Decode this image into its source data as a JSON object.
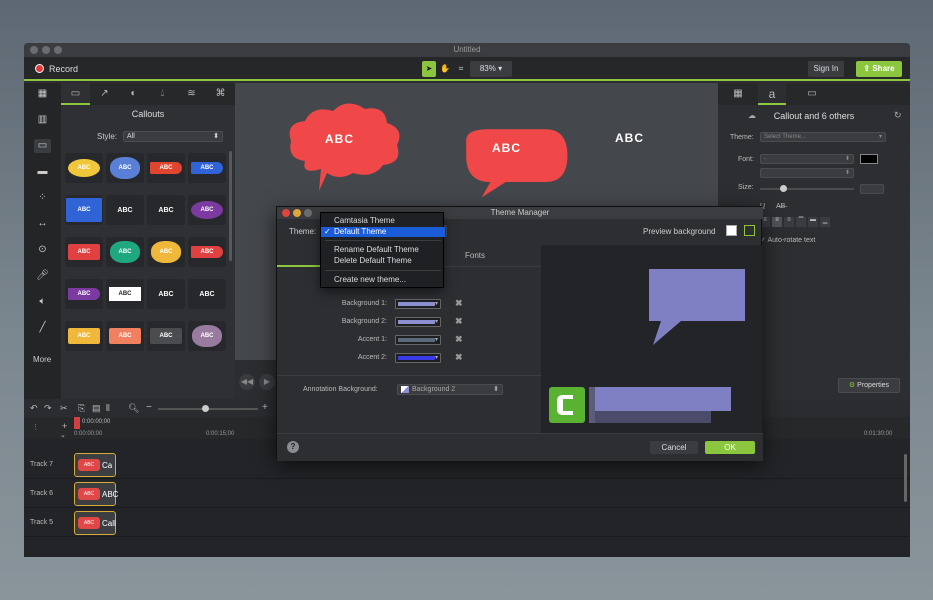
{
  "window": {
    "title": "Untitled"
  },
  "toolbar": {
    "record_label": "Record",
    "zoom": "83%",
    "signin_label": "Sign In",
    "share_label": "Share"
  },
  "library": {
    "title": "Callouts",
    "style_label": "Style:",
    "style_value": "All",
    "more_label": "More",
    "callouts": [
      {
        "text": "ABC",
        "color": "#f0c63a",
        "shape": "oval"
      },
      {
        "text": "ABC",
        "color": "#5a7fd6",
        "shape": "cloud"
      },
      {
        "text": "ABC",
        "color": "#e0452f",
        "shape": "arrow"
      },
      {
        "text": "ABC",
        "color": "#2f63d6",
        "shape": "arrow"
      },
      {
        "text": "ABC",
        "color": "#2f63d6",
        "shape": "rect"
      },
      {
        "text": "ABC",
        "color": "none",
        "shape": "text"
      },
      {
        "text": "ABC",
        "color": "none",
        "shape": "text"
      },
      {
        "text": "ABC",
        "color": "#7a3aa0",
        "shape": "oval"
      },
      {
        "text": "ABC",
        "color": "#e04040",
        "shape": "speech"
      },
      {
        "text": "ABC",
        "color": "#1fa880",
        "shape": "cloud"
      },
      {
        "text": "ABC",
        "color": "#f0b83a",
        "shape": "cloud"
      },
      {
        "text": "ABC",
        "color": "#e04040",
        "shape": "arrow"
      },
      {
        "text": "ABC",
        "color": "#7a3aa0",
        "shape": "arrow"
      },
      {
        "text": "ABC",
        "color": "#ffffff",
        "shape": "box"
      },
      {
        "text": "ABC",
        "color": "none",
        "shape": "text"
      },
      {
        "text": "ABC",
        "color": "none",
        "shape": "text"
      },
      {
        "text": "ABC",
        "color": "#f0b83a",
        "shape": "speech"
      },
      {
        "text": "ABC",
        "color": "#f08060",
        "shape": "speech"
      },
      {
        "text": "ABC",
        "color": "#4a4c50",
        "shape": "speech"
      },
      {
        "text": "ABC",
        "color": "#9a7ba0",
        "shape": "cloud"
      }
    ]
  },
  "canvas": {
    "callouts": [
      {
        "text": "ABC",
        "color": "#f04848",
        "shape": "cloud"
      },
      {
        "text": "ABC",
        "color": "#f04848",
        "shape": "speech"
      },
      {
        "text": "ABC",
        "color": "none",
        "shape": "text"
      }
    ]
  },
  "properties": {
    "title": "Callout and 6 others",
    "theme_label": "Theme:",
    "theme_value": "Select Theme...",
    "font_label": "Font:",
    "font_value": "-",
    "size_label": "Size:",
    "autorotate_label": "Auto-rotate text",
    "properties_button": "Properties"
  },
  "timeline": {
    "times": [
      "0:00:00;00",
      "0:00:15;00",
      "0:01:30;00"
    ],
    "playhead": "0:00:00;00",
    "tracks": [
      {
        "label": "Track 7",
        "clip_text": "Ca",
        "clip_color": "#e04848"
      },
      {
        "label": "Track 6",
        "clip_text": "ABC",
        "clip_color": "#e04848"
      },
      {
        "label": "Track 5",
        "clip_text": "Call",
        "clip_color": "#e04848"
      }
    ]
  },
  "dialog": {
    "title": "Theme Manager",
    "theme_label": "Theme:",
    "preview_label": "Preview background",
    "tab_fonts": "Fonts",
    "rows": [
      {
        "label": "Background 1:",
        "color": "#8c8fd0"
      },
      {
        "label": "Background 2:",
        "color": "#8c8fd0"
      },
      {
        "label": "Accent 1:",
        "color": "#5a6a7a"
      },
      {
        "label": "Accent 2:",
        "color": "#3a3ae8"
      }
    ],
    "annotation_label": "Annotation Background:",
    "annotation_value": "Background 2",
    "cancel_label": "Cancel",
    "ok_label": "OK",
    "help_label": "?",
    "preview_callout_color": "#7f7fc4",
    "preview_bar_color": "#7f7fc4",
    "logo_color": "#5ab233",
    "menu": {
      "items": [
        "Camtasia Theme",
        "Default Theme",
        "Rename Default Theme",
        "Delete Default Theme",
        "Create new theme..."
      ],
      "selected": "Default Theme",
      "check": "✓"
    }
  }
}
